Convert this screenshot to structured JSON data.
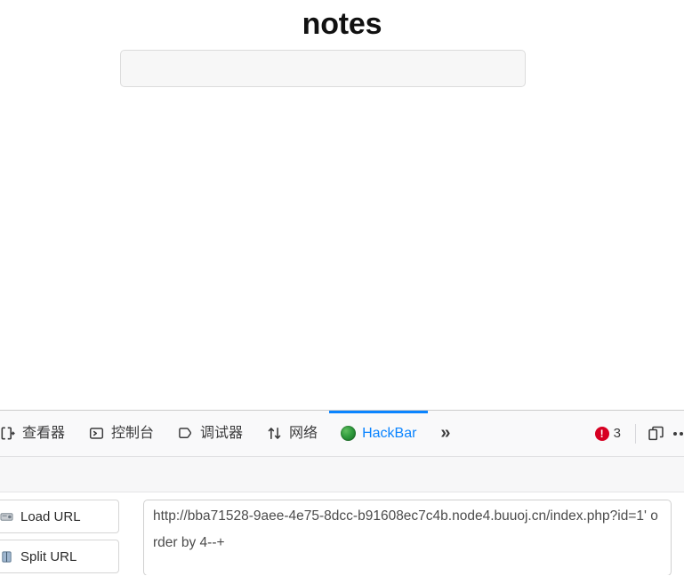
{
  "page": {
    "title": "notes",
    "note_box": {
      "name": "note-input",
      "value": "",
      "placeholder": ""
    }
  },
  "devtools": {
    "tabs": [
      {
        "label": "查看器",
        "icon": "inspector-icon",
        "active": false
      },
      {
        "label": "控制台",
        "icon": "console-icon",
        "active": false
      },
      {
        "label": "调试器",
        "icon": "debugger-icon",
        "active": false
      },
      {
        "label": "网络",
        "icon": "network-icon",
        "active": false
      },
      {
        "label": "HackBar",
        "icon": "hackbar-icon",
        "active": true
      }
    ],
    "overflow_label": "»",
    "errors": {
      "count": "3",
      "badge_glyph": "!",
      "color": "#d70022"
    },
    "responsive_mode_icon": "responsive-design-mode-icon",
    "more_menu_icon": "meatball-menu-icon",
    "accent_color": "#0a84ff"
  },
  "hackbar": {
    "buttons": [
      {
        "label": "Load URL",
        "icon": "load-url-icon"
      },
      {
        "label": "Split URL",
        "icon": "split-url-icon"
      }
    ],
    "url_field": {
      "value": "http://bba71528-9aee-4e75-8dcc-b91608ec7c4b.node4.buuoj.cn/index.php?id=1' order by 4--+",
      "placeholder": ""
    }
  }
}
